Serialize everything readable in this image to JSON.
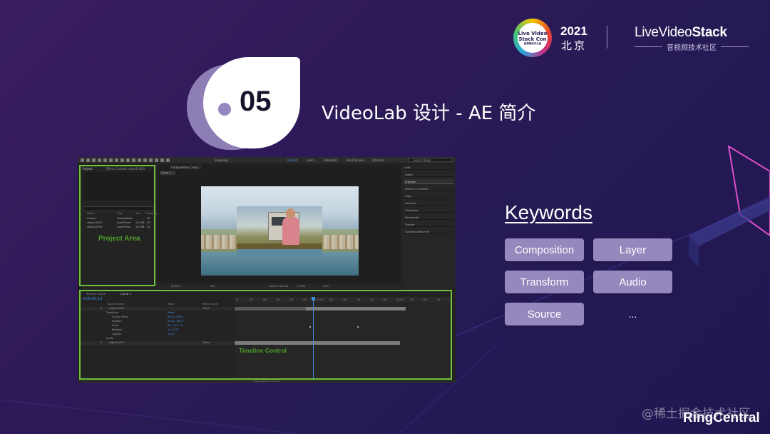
{
  "header": {
    "conference_logo_lines": [
      "Live Video",
      "Stack Con",
      "音视频技术大会"
    ],
    "year": "2021",
    "city": "北京",
    "brand_prefix": "ive",
    "brand_l": "L",
    "brand_middle": "Video",
    "brand_strong": "Stack",
    "brand_subtitle": "音视频技术社区"
  },
  "section": {
    "number": "05",
    "title": "VideoLab 设计 - AE 简介"
  },
  "ae_screenshot": {
    "toolbar_workspaces": [
      "Default",
      "Learn",
      "Standard",
      "Small Screen",
      "Libraries"
    ],
    "active_workspace": "Default",
    "snapping_label": "Snapping",
    "search_placeholder": "Search Help",
    "project_tab": "Project",
    "effect_controls_tab": "Effect Controls video1.MOV",
    "project_columns": [
      "Name",
      "Type",
      "Size",
      "Frame Ra"
    ],
    "project_items": [
      {
        "name": "Comp 1",
        "type": "Composition",
        "size": "",
        "rate": "30"
      },
      {
        "name": "video1.MOV",
        "type": "QuickTime",
        "size": "1.3 MB",
        "rate": "30"
      },
      {
        "name": "video2.MOV",
        "type": "QuickTime",
        "size": "3.6 MB",
        "rate": "30"
      }
    ],
    "project_area_label": "Project Area",
    "composition_tab": "Composition Comp 1",
    "comp_subtab": "Comp 1",
    "right_panel_items": [
      "Info",
      "Audio",
      "Preview",
      "Effects & Presets",
      "Align",
      "Libraries",
      "Character",
      "Paragraph",
      "Tracker",
      "Content-Aware Fill"
    ],
    "right_panel_selected": "Preview",
    "viewer_controls": [
      "(100%)",
      "Full",
      "Active Camera",
      "1 View",
      "+0.0"
    ],
    "timeline_tabs": [
      "Render Queue",
      "Comp 1"
    ],
    "timecode": "0;00;00;13",
    "timeline_columns": [
      "Source Name",
      "Mode",
      "Parent & Link"
    ],
    "timeline_rows": [
      {
        "kind": "layer",
        "index": "1",
        "name": "video2.MOV",
        "mode": "None"
      },
      {
        "kind": "group",
        "name": "Transform",
        "value": "Reset"
      },
      {
        "kind": "prop",
        "name": "Anchor Point",
        "value": "640.0, 360.0"
      },
      {
        "kind": "prop",
        "name": "Position",
        "value": "640.0, 360.0"
      },
      {
        "kind": "prop",
        "name": "Scale",
        "value": "65.7, 65.7 %"
      },
      {
        "kind": "prop",
        "name": "Rotation",
        "value": "0x +0.0°"
      },
      {
        "kind": "prop",
        "name": "Opacity",
        "value": "100%"
      },
      {
        "kind": "group",
        "name": "Audio",
        "value": ""
      },
      {
        "kind": "layer",
        "index": "2",
        "name": "video1.MOV",
        "mode": "None"
      }
    ],
    "ruler_ticks": [
      "0f",
      "05f",
      "10f",
      "15f",
      "20f",
      "25f",
      "01:00f",
      "05f",
      "10f",
      "15f",
      "20f",
      "25f",
      "02:00f",
      "05f",
      "10f",
      "15f"
    ],
    "timeline_control_label": "Timeline Control",
    "status_bar": "Toggle Switches / Modes"
  },
  "keywords": {
    "title": "Keywords",
    "items": [
      "Composition",
      "Layer",
      "Transform",
      "Audio",
      "Source"
    ],
    "more": "..."
  },
  "footer": {
    "company": "RingCentral",
    "watermark": "@稀土掘金技术社区"
  },
  "colors": {
    "background": "#2e1a58",
    "keyword_button": "#9488bd",
    "highlight_border": "#6fbf3d",
    "ae_accent_blue": "#3d8fe0"
  }
}
